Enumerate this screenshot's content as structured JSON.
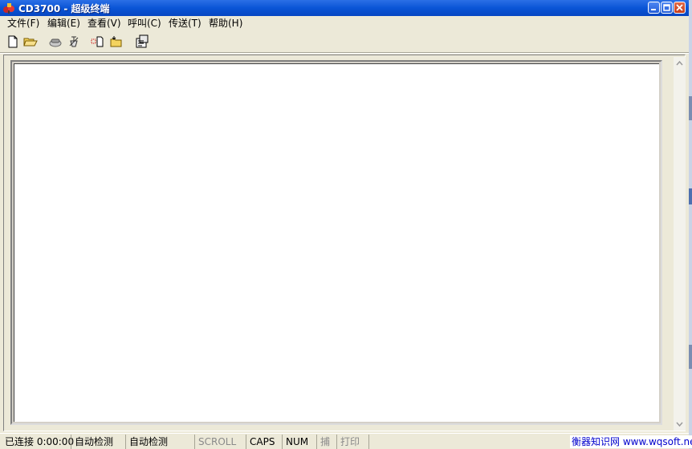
{
  "window": {
    "title": "CD3700 - 超级终端",
    "icon": "hyperterminal-icon",
    "controls": [
      "minimize",
      "maximize",
      "close"
    ]
  },
  "menu": [
    {
      "label": "文件(F)"
    },
    {
      "label": "编辑(E)"
    },
    {
      "label": "查看(V)"
    },
    {
      "label": "呼叫(C)"
    },
    {
      "label": "传送(T)"
    },
    {
      "label": "帮助(H)"
    }
  ],
  "toolbar": {
    "buttons": [
      "new-icon",
      "open-icon",
      "call-icon",
      "disconnect-icon",
      "send-icon",
      "receive-icon",
      "properties-icon"
    ]
  },
  "status": {
    "connected": "已连接 0:00:00",
    "detect1": "自动检测",
    "detect2": "自动检测",
    "scroll": "SCROLL",
    "caps": "CAPS",
    "num": "NUM",
    "capture": "捕",
    "print": "打印"
  },
  "watermark": "衡器知识网 www.wqsoft.net",
  "colors": {
    "titlebar": "#0a55d6",
    "chrome": "#ece9d8",
    "terminal_bg": "#ffffff"
  }
}
